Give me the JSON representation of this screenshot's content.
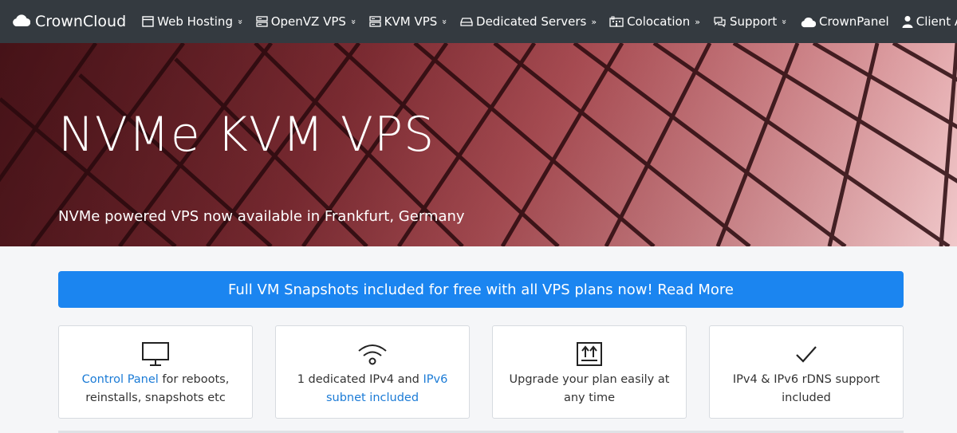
{
  "brand": {
    "name": "CrownCloud",
    "icon": "cloud-icon"
  },
  "nav": {
    "left": [
      {
        "label": "Web Hosting",
        "icon": "browser-icon",
        "chevron": "»"
      },
      {
        "label": "OpenVZ VPS",
        "icon": "server-icon",
        "chevron": "»"
      },
      {
        "label": "KVM VPS",
        "icon": "server-icon",
        "chevron": "»"
      },
      {
        "label": "Dedicated Servers",
        "icon": "hdd-icon",
        "chevron": "»"
      },
      {
        "label": "Colocation",
        "icon": "building-icon",
        "chevron": "»"
      }
    ],
    "right": [
      {
        "label": "Support",
        "icon": "chat-icon",
        "chevron": "»"
      },
      {
        "label": "CrownPanel",
        "icon": "cloud-icon"
      },
      {
        "label": "Client Area",
        "icon": "user-icon"
      }
    ]
  },
  "hero": {
    "title": "NVMe KVM VPS",
    "subtitle": "NVMe powered VPS now available in Frankfurt, Germany"
  },
  "announcement": "Full VM Snapshots included for free with all VPS plans now! Read More",
  "features": [
    {
      "icon": "monitor-icon",
      "link": "Control Panel",
      "text": " for reboots, reinstalls, snapshots etc"
    },
    {
      "icon": "wifi-icon",
      "pre": "1 dedicated IPv4 and ",
      "link": "IPv6 subnet included"
    },
    {
      "icon": "upgrade-icon",
      "text": "Upgrade your plan easily at any time"
    },
    {
      "icon": "check-icon",
      "text": "IPv4 & IPv6 rDNS support included"
    }
  ],
  "colors": {
    "navbar": "#343a40",
    "accent": "#1b85f0",
    "link": "#1b7bd6"
  }
}
